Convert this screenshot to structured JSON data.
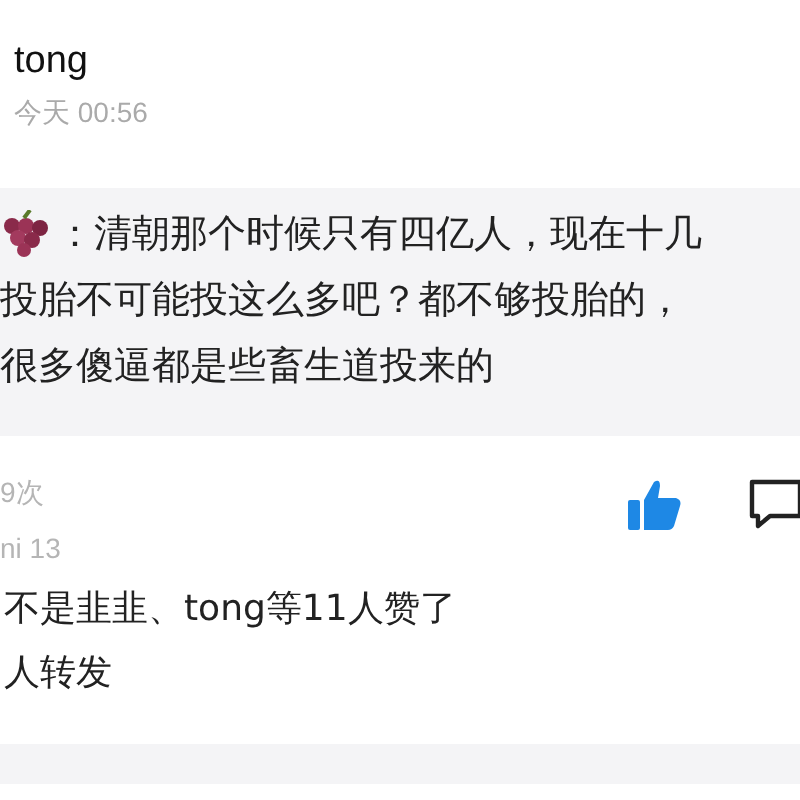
{
  "post": {
    "author": "tong",
    "time": "今天 00:56"
  },
  "quote": {
    "lines": [
      "：清朝那个时候只有四亿人，现在十几",
      "投胎不可能投这么多吧？都不够投胎的，",
      "很多傻逼都是些畜生道投来的"
    ]
  },
  "stats": {
    "views": "9次",
    "device": "ni 13",
    "liked": true
  },
  "likes": "不是韭韭、tong等11人赞了",
  "reposts": "人转发"
}
